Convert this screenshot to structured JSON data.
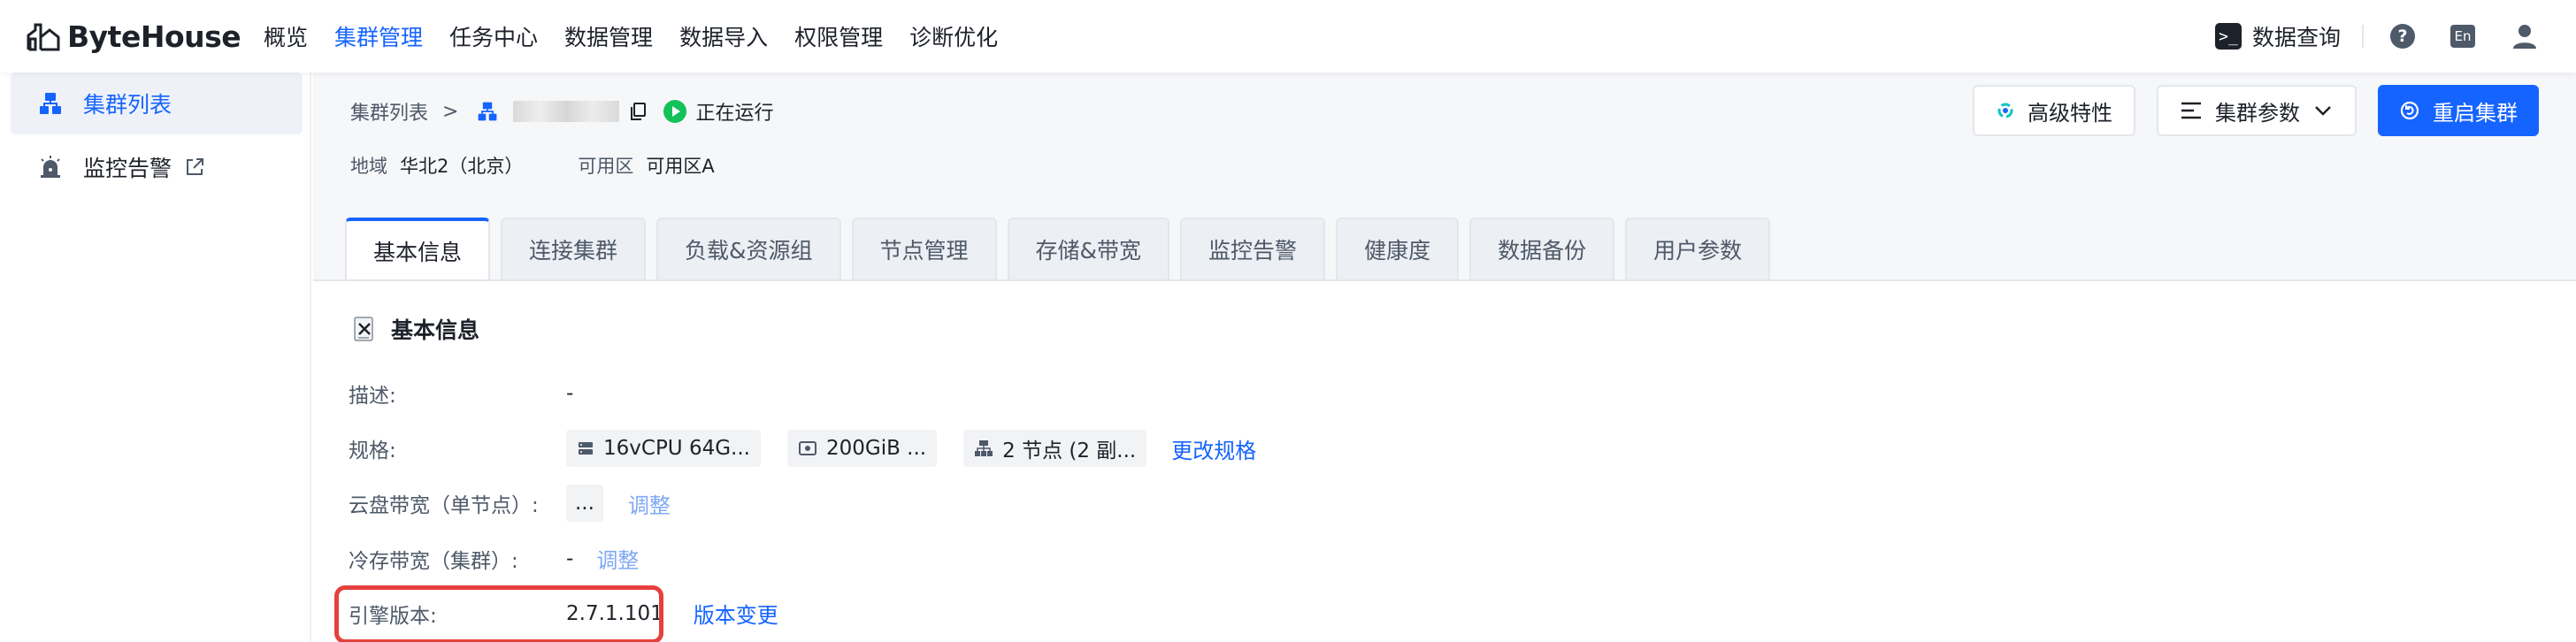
{
  "app": {
    "logo_text": "ByteHouse"
  },
  "nav": {
    "items": [
      "概览",
      "集群管理",
      "任务中心",
      "数据管理",
      "数据导入",
      "权限管理",
      "诊断优化"
    ],
    "active_index": 1,
    "data_query": "数据查询",
    "lang": "En"
  },
  "sidebar": {
    "items": [
      {
        "label": "集群列表",
        "icon": "cluster-icon",
        "active": true
      },
      {
        "label": "监控告警",
        "icon": "alarm-icon",
        "external": true
      }
    ]
  },
  "breadcrumb": {
    "parent": "集群列表",
    "separator": ">",
    "status": "正在运行"
  },
  "region": {
    "label": "地域",
    "value": "华北2（北京）",
    "zone_label": "可用区",
    "zone_value": "可用区A"
  },
  "actions": {
    "advanced": "高级特性",
    "params": "集群参数",
    "restart": "重启集群"
  },
  "tabs": [
    "基本信息",
    "连接集群",
    "负载&资源组",
    "节点管理",
    "存储&带宽",
    "监控告警",
    "健康度",
    "数据备份",
    "用户参数"
  ],
  "info": {
    "title": "基本信息",
    "desc_label": "描述:",
    "desc_value": "-",
    "spec_label": "规格:",
    "spec_cpu": "16vCPU 64G...",
    "spec_disk": "200GiB ...",
    "spec_nodes": "2 节点 (2 副...",
    "spec_change": "更改规格",
    "cloud_bw_label": "云盘带宽（单节点）:",
    "cloud_bw_value": "...",
    "cloud_bw_adjust": "调整",
    "cold_bw_label": "冷存带宽（集群）:",
    "cold_bw_value": "-",
    "cold_bw_adjust": "调整",
    "engine_label": "引擎版本:",
    "engine_value": "2.7.1.101",
    "engine_change": "版本变更"
  },
  "colors": {
    "primary": "#1664ff",
    "running": "#14c25b",
    "highlight": "#e5403c"
  }
}
